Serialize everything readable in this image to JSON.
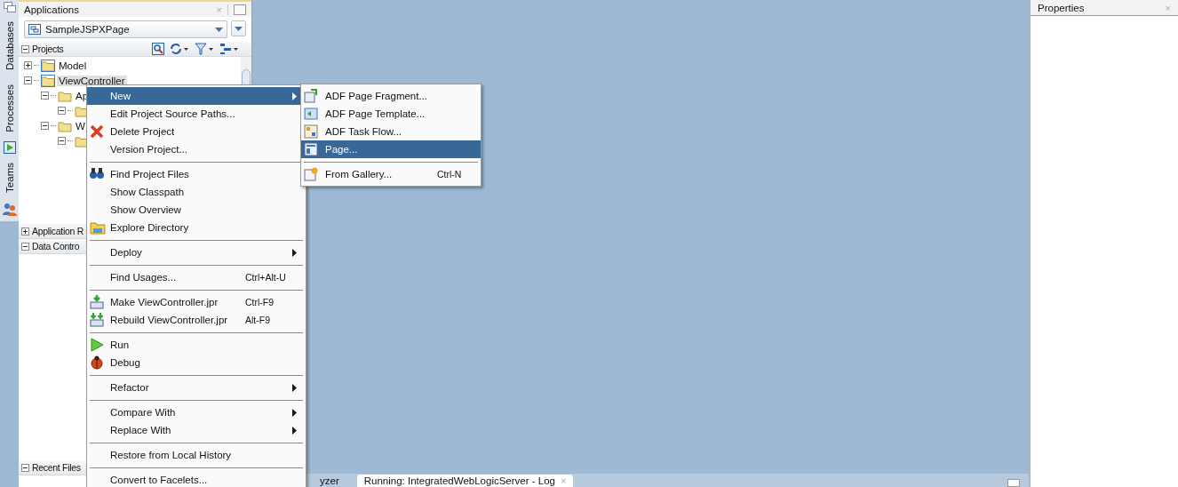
{
  "side_tabs": [
    {
      "label": "Databases"
    },
    {
      "label": "Processes"
    },
    {
      "label": "Teams"
    }
  ],
  "applications_panel": {
    "title": "Applications",
    "close": "×",
    "application": "SampleJSPXPage",
    "sections": [
      {
        "label": "Projects",
        "expanded": true,
        "tree": [
          {
            "label": "Model",
            "expanded": false,
            "selected": false
          },
          {
            "label": "ViewController",
            "expanded": true,
            "selected": true,
            "children": [
              {
                "label": "Ap",
                "expanded": true,
                "selected": false,
                "children": [
                  {
                    "expanded": true
                  }
                ]
              },
              {
                "label": "W",
                "expanded": true,
                "selected": false,
                "children": [
                  {
                    "expanded": true
                  }
                ]
              }
            ]
          }
        ]
      },
      {
        "label": "Application R",
        "expanded": false
      },
      {
        "label": "Data Contro",
        "expanded": true
      },
      {
        "label": "Recent Files",
        "expanded": true
      }
    ]
  },
  "context_menu": {
    "items": [
      {
        "kind": "item",
        "label": "New",
        "submenu": true,
        "selected": true
      },
      {
        "kind": "item",
        "label": "Edit Project Source Paths...",
        "selected": false
      },
      {
        "kind": "item",
        "label": "Delete Project",
        "selected": false
      },
      {
        "kind": "item",
        "label": "Version Project...",
        "selected": false
      },
      {
        "kind": "separator"
      },
      {
        "kind": "item",
        "label": "Find Project Files",
        "selected": false
      },
      {
        "kind": "item",
        "label": "Show Classpath",
        "selected": false
      },
      {
        "kind": "item",
        "label": "Show Overview",
        "selected": false
      },
      {
        "kind": "item",
        "label": "Explore Directory",
        "selected": false
      },
      {
        "kind": "separator"
      },
      {
        "kind": "item",
        "label": "Deploy",
        "submenu": true,
        "selected": false
      },
      {
        "kind": "separator"
      },
      {
        "kind": "item",
        "label": "Find Usages...",
        "shortcut": "Ctrl+Alt-U",
        "selected": false
      },
      {
        "kind": "separator"
      },
      {
        "kind": "item",
        "label": "Make ViewController.jpr",
        "shortcut": "Ctrl-F9",
        "selected": false
      },
      {
        "kind": "item",
        "label": "Rebuild ViewController.jpr",
        "shortcut": "Alt-F9",
        "selected": false
      },
      {
        "kind": "separator"
      },
      {
        "kind": "item",
        "label": "Run",
        "selected": false
      },
      {
        "kind": "item",
        "label": "Debug",
        "selected": false
      },
      {
        "kind": "separator"
      },
      {
        "kind": "item",
        "label": "Refactor",
        "submenu": true,
        "selected": false
      },
      {
        "kind": "separator"
      },
      {
        "kind": "item",
        "label": "Compare With",
        "submenu": true,
        "selected": false
      },
      {
        "kind": "item",
        "label": "Replace With",
        "submenu": true,
        "selected": false
      },
      {
        "kind": "separator"
      },
      {
        "kind": "item",
        "label": "Restore from Local History",
        "selected": false
      },
      {
        "kind": "separator"
      },
      {
        "kind": "item",
        "label": "Convert to Facelets...",
        "selected": false
      }
    ]
  },
  "new_submenu": {
    "items": [
      {
        "kind": "item",
        "label": "ADF Page Fragment...",
        "selected": false
      },
      {
        "kind": "item",
        "label": "ADF Page Template...",
        "selected": false
      },
      {
        "kind": "item",
        "label": "ADF Task Flow...",
        "selected": false
      },
      {
        "kind": "item",
        "label": "Page...",
        "selected": true
      },
      {
        "kind": "separator"
      },
      {
        "kind": "item",
        "label": "From Gallery...",
        "shortcut": "Ctrl-N",
        "selected": false
      }
    ]
  },
  "bottom_tabs": [
    {
      "label": "yzer",
      "selected": false
    },
    {
      "label": "Running: IntegratedWebLogicServer - Log",
      "selected": true,
      "close": "×"
    }
  ],
  "properties_panel": {
    "title": "Properties",
    "close": "×"
  }
}
